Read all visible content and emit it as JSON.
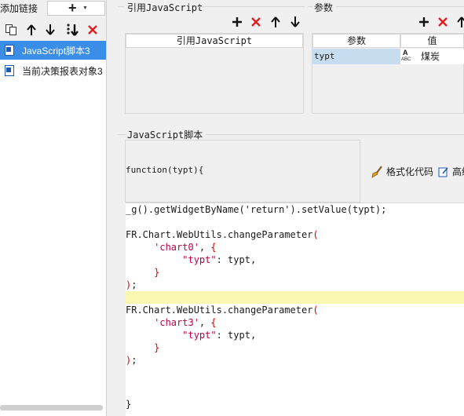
{
  "left_panel": {
    "add_link_label": "添加链接",
    "add_button_label": "+",
    "items": [
      {
        "label": "JavaScript脚本3",
        "selected": true
      },
      {
        "label": "当前决策报表对象3",
        "selected": false
      }
    ]
  },
  "ref_js": {
    "section_title": "引用JavaScript",
    "column_header": "引用JavaScript"
  },
  "params": {
    "section_title": "参数",
    "col_param": "参数",
    "col_value": "值",
    "row": {
      "name": "typt",
      "type_badge_top": "A",
      "type_badge_bottom": "ABC",
      "value": "煤炭"
    }
  },
  "script": {
    "section_title": "JavaScript脚本",
    "function_signature": "function(typt){",
    "format_code_label": "格式化代码",
    "advanced_label": "高级",
    "lines": [
      "_g().getWidgetByName('return').setValue(typt);",
      "",
      "FR.Chart.WebUtils.changeParameter(",
      "     'chart0', {",
      "          \"typt\": typt,",
      "     }",
      ");",
      "",
      "FR.Chart.WebUtils.changeParameter(",
      "     'chart3', {",
      "          \"typt\": typt,",
      "     }",
      ");"
    ],
    "closing": "}"
  },
  "colors": {
    "selection": "#3b8ee8",
    "delete_red": "#e02020",
    "highlight": "#fbf8b2",
    "param_cell": "#c7dcee"
  }
}
